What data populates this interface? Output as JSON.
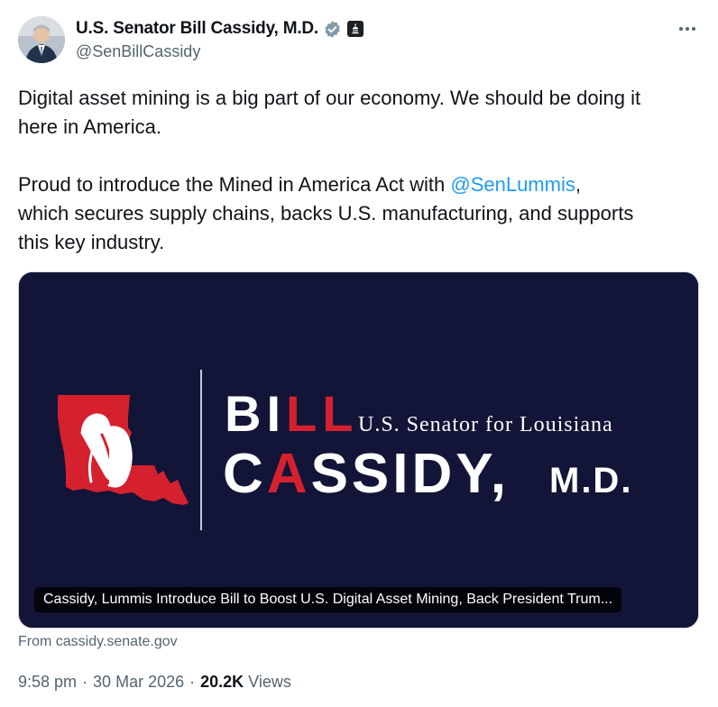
{
  "author": {
    "display_name": "U.S. Senator Bill Cassidy, M.D.",
    "handle": "@SenBillCassidy",
    "verified_color": "#829aab"
  },
  "tweet": {
    "line1": "Digital asset mining is a big part of our economy. We should be doing it",
    "line2": "here in America.",
    "line3_prefix": "Proud to introduce the Mined in America Act with ",
    "mention": "@SenLummis",
    "line3_suffix": ",",
    "line4": "which secures supply chains, backs U.S. manufacturing, and supports",
    "line5": "this key industry."
  },
  "card": {
    "logo_word1_a": "BI",
    "logo_word1_b": "LL",
    "logo_word2_a": "C",
    "logo_word2_b": "A",
    "logo_word2_c": "SSIDY,",
    "logo_suffix": "M.D.",
    "logo_subtitle": "U.S. Senator for Louisiana",
    "caption": "Cassidy, Lummis Introduce Bill to Boost U.S. Digital Asset Mining, Back President Trum...",
    "background_color": "#131538",
    "accent_color": "#d5212e"
  },
  "source": "From cassidy.senate.gov",
  "meta": {
    "time": "9:58 pm",
    "date": "30 Mar 2026",
    "separator": "·",
    "views_count": "20.2K",
    "views_label": "Views"
  }
}
